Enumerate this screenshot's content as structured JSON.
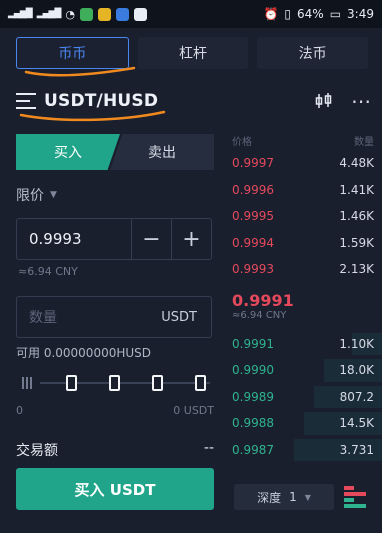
{
  "statusbar": {
    "battery": "64%",
    "time": "3:49",
    "network": "4G"
  },
  "top_tabs": [
    {
      "label": "币币",
      "active": true
    },
    {
      "label": "杠杆",
      "active": false
    },
    {
      "label": "法币",
      "active": false
    }
  ],
  "pair": {
    "name": "USDT/HUSD"
  },
  "trade": {
    "buy_label": "买入",
    "sell_label": "卖出",
    "order_type": "限价",
    "price_value": "0.9993",
    "price_cny": "≈6.94 CNY",
    "qty_placeholder": "数量",
    "qty_unit": "USDT",
    "available": "可用 0.00000000HUSD",
    "slider_min": "0",
    "slider_max": "0 USDT",
    "slider_level": 0,
    "amount_label": "交易额",
    "amount_value": "--",
    "buy_button": "买入 USDT"
  },
  "orderbook": {
    "price_header": "价格",
    "qty_header": "数量",
    "asks": [
      {
        "price": "0.9997",
        "qty": "4.48K"
      },
      {
        "price": "0.9996",
        "qty": "1.41K"
      },
      {
        "price": "0.9995",
        "qty": "1.46K"
      },
      {
        "price": "0.9994",
        "qty": "1.59K"
      },
      {
        "price": "0.9993",
        "qty": "2.13K"
      }
    ],
    "last_price": "0.9991",
    "last_cny": "≈6.94 CNY",
    "bids": [
      {
        "price": "0.9991",
        "qty": "1.10K"
      },
      {
        "price": "0.9990",
        "qty": "18.0K"
      },
      {
        "price": "0.9989",
        "qty": "807.2"
      },
      {
        "price": "0.9988",
        "qty": "14.5K"
      },
      {
        "price": "0.9987",
        "qty": "3.731"
      }
    ],
    "depth_label": "深度",
    "depth_value": "1"
  },
  "colors": {
    "buy": "#21a58a",
    "sell": "#e4495c",
    "accent": "#4a86f0",
    "annotation": "#f08a1e"
  }
}
